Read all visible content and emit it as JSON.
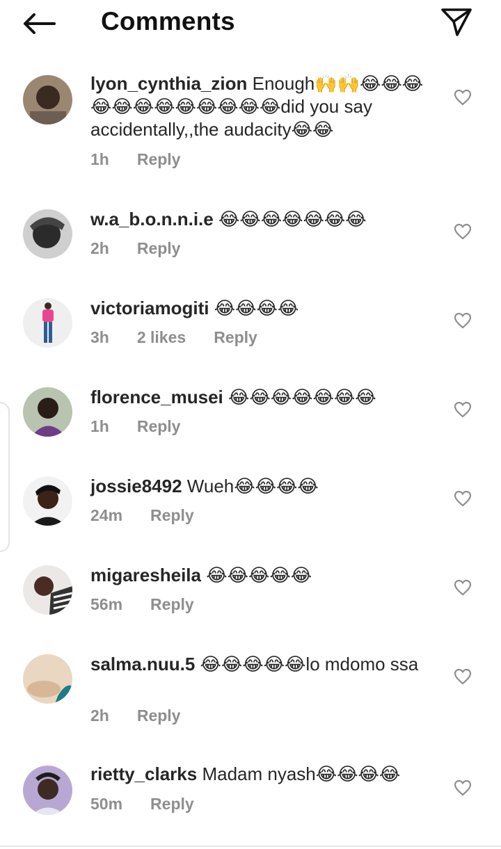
{
  "header": {
    "back_icon": "arrow-left-icon",
    "title": "Comments",
    "share_icon": "paper-plane-icon"
  },
  "reply_label": "Reply",
  "comments": [
    {
      "username": "lyon_cynthia_zion",
      "text": "Enough🙌🙌😂😂😂😂😂😂😂😂😂😂😂😂did you say accidentally,,the audacity😂😂",
      "time": "1h",
      "likes": "",
      "like_icon": "heart-outline-icon"
    },
    {
      "username": "w.a_b.o.n.n.i.e",
      "text": "😂😂😂😂😂😂😂",
      "time": "2h",
      "likes": "",
      "like_icon": "heart-outline-icon"
    },
    {
      "username": "victoriamogiti",
      "text": "😂😂😂😂",
      "time": "3h",
      "likes": "2 likes",
      "like_icon": "heart-outline-icon"
    },
    {
      "username": "florence_musei",
      "text": "😂😂😂😂😂😂😂",
      "time": "1h",
      "likes": "",
      "like_icon": "heart-outline-icon"
    },
    {
      "username": "jossie8492",
      "text": "Wueh😂😂😂😂",
      "time": "24m",
      "likes": "",
      "like_icon": "heart-outline-icon"
    },
    {
      "username": "migaresheila",
      "text": "😂😂😂😂😂",
      "time": "56m",
      "likes": "",
      "like_icon": "heart-outline-icon"
    },
    {
      "username": "salma.nuu.5",
      "text": "😂😂😂😂😂lo mdomo ssa",
      "time": "2h",
      "likes": "",
      "like_icon": "heart-outline-icon"
    },
    {
      "username": "rietty_clarks",
      "text": "Madam nyash😂😂😂😂",
      "time": "50m",
      "likes": "",
      "like_icon": "heart-outline-icon"
    }
  ]
}
